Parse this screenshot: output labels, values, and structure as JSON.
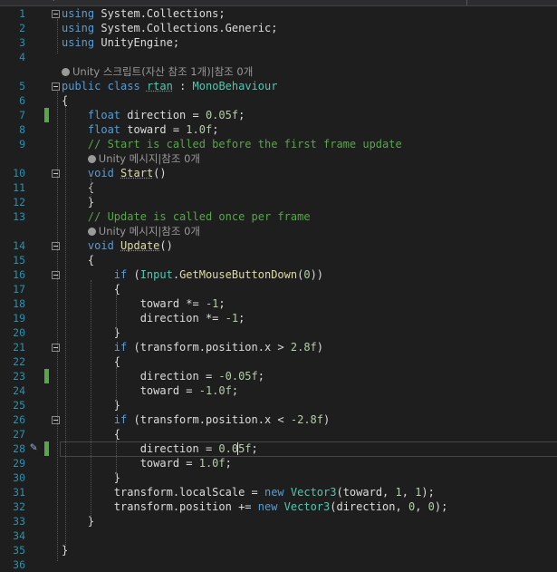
{
  "editor": {
    "lines": [
      {
        "n": "1",
        "html": "<span class=\"kw\">using</span> System.Collections;",
        "fold": true
      },
      {
        "n": "2",
        "html": "<span class=\"kw\">using</span> System.Collections.Generic;"
      },
      {
        "n": "3",
        "html": "<span class=\"kw\">using</span> UnityEngine;"
      },
      {
        "n": "4",
        "html": ""
      },
      {
        "lens": "Unity 스크립트(자산 참조 1개)|참조 0개"
      },
      {
        "n": "5",
        "html": "<span class=\"kw\">public</span> <span class=\"kw\">class</span> <span class=\"ty underline\">rtan</span> : <span class=\"ty\">MonoBehaviour</span>",
        "fold": true
      },
      {
        "n": "6",
        "html": "{"
      },
      {
        "n": "7",
        "html": "    <span class=\"kw\">float</span> direction = <span class=\"num\">0.05f</span>;",
        "mark": true
      },
      {
        "n": "8",
        "html": "    <span class=\"kw\">float</span> toward = <span class=\"num\">1.0f</span>;"
      },
      {
        "n": "9",
        "html": "    <span class=\"cm\">// Start is called before the first frame update</span>"
      },
      {
        "lens": "Unity 메시지|참조 0개"
      },
      {
        "n": "10",
        "html": "    <span class=\"kw\">void</span> <span class=\"fn underline\">Start</span>()",
        "fold": true
      },
      {
        "n": "11",
        "html": "    {"
      },
      {
        "n": "12",
        "html": "    }"
      },
      {
        "n": "13",
        "html": "    <span class=\"cm\">// Update is called once per frame</span>"
      },
      {
        "lens": "Unity 메시지|참조 0개"
      },
      {
        "n": "14",
        "html": "    <span class=\"kw\">void</span> <span class=\"fn underline\">Update</span>()",
        "fold": true
      },
      {
        "n": "15",
        "html": "    {"
      },
      {
        "n": "16",
        "html": "        <span class=\"kw\">if</span> (<span class=\"ty\">Input</span>.<span class=\"fn\">GetMouseButtonDown</span>(<span class=\"num\">0</span>))",
        "fold": true
      },
      {
        "n": "17",
        "html": "        {"
      },
      {
        "n": "18",
        "html": "            toward *= <span class=\"num\">-1</span>;"
      },
      {
        "n": "19",
        "html": "            direction *= <span class=\"num\">-1</span>;"
      },
      {
        "n": "20",
        "html": "        }"
      },
      {
        "n": "21",
        "html": "        <span class=\"kw\">if</span> (transform.position.x &gt; <span class=\"num\">2.8f</span>)",
        "fold": true
      },
      {
        "n": "22",
        "html": "        {"
      },
      {
        "n": "23",
        "html": "            direction = <span class=\"num\">-0.05f</span>;",
        "mark": true
      },
      {
        "n": "24",
        "html": "            toward = <span class=\"num\">-1.0f</span>;"
      },
      {
        "n": "25",
        "html": "        }"
      },
      {
        "n": "26",
        "html": "        <span class=\"kw\">if</span> (transform.position.x &lt; <span class=\"num\">-2.8f</span>)",
        "fold": true
      },
      {
        "n": "27",
        "html": "        {"
      },
      {
        "n": "28",
        "html": "            direction = <span class=\"num\">0.05f</span>;",
        "mark": true,
        "current": true
      },
      {
        "n": "29",
        "html": "            toward = <span class=\"num\">1.0f</span>;"
      },
      {
        "n": "30",
        "html": "        }"
      },
      {
        "n": "31",
        "html": "        transform.localScale = <span class=\"kw\">new</span> <span class=\"ty\">Vector3</span>(toward, <span class=\"num\">1</span>, <span class=\"num\">1</span>);"
      },
      {
        "n": "32",
        "html": "        transform.position += <span class=\"kw\">new</span> <span class=\"ty\">Vector3</span>(direction, <span class=\"num\">0</span>, <span class=\"num\">0</span>);"
      },
      {
        "n": "33",
        "html": "    }"
      },
      {
        "n": "34",
        "html": ""
      },
      {
        "n": "35",
        "html": "}"
      },
      {
        "n": "36",
        "html": ""
      }
    ]
  },
  "colors": {
    "background": "#1e1e1e",
    "keyword": "#569cd6",
    "type": "#4ec9b0",
    "comment": "#57a64a",
    "number": "#b5cea8",
    "line_number": "#2b91af",
    "change_marker": "#57a64a"
  },
  "icons": [
    "codelens-icon",
    "fold-toggle-icon",
    "quick-action-pencil-icon"
  ]
}
